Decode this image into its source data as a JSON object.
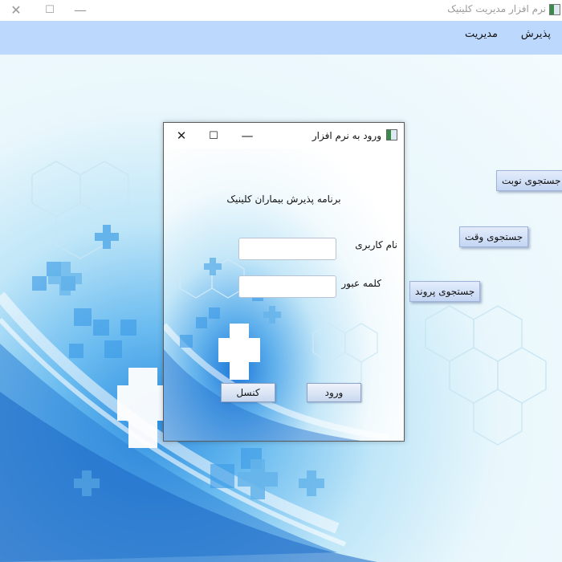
{
  "window": {
    "title": "نرم افزار مدیریت کلینیک",
    "controls": {
      "minimize": "—",
      "maximize": "☐",
      "close": "✕"
    }
  },
  "menu": {
    "items": [
      {
        "label": "پذیرش"
      },
      {
        "label": "مدیریت"
      }
    ]
  },
  "side_buttons": {
    "search_turn": "جستجوی نوبت",
    "search_time": "جستجوی وقت",
    "search_file": "جستجوی پروند"
  },
  "login_dialog": {
    "title": "ورود به نرم افزار",
    "controls": {
      "minimize": "—",
      "maximize": "☐",
      "close": "✕"
    },
    "heading": "برنامه پذیرش بیماران کلینیک",
    "username_label": "نام کاربری",
    "username_value": "",
    "password_label": "کلمه عبور",
    "password_value": "",
    "login_button": "ورود",
    "cancel_button": "کنسل"
  },
  "colors": {
    "menubar": "#bcd9fd",
    "accent_blue": "#2f8fe0",
    "button_face": "#c4d6f3"
  }
}
